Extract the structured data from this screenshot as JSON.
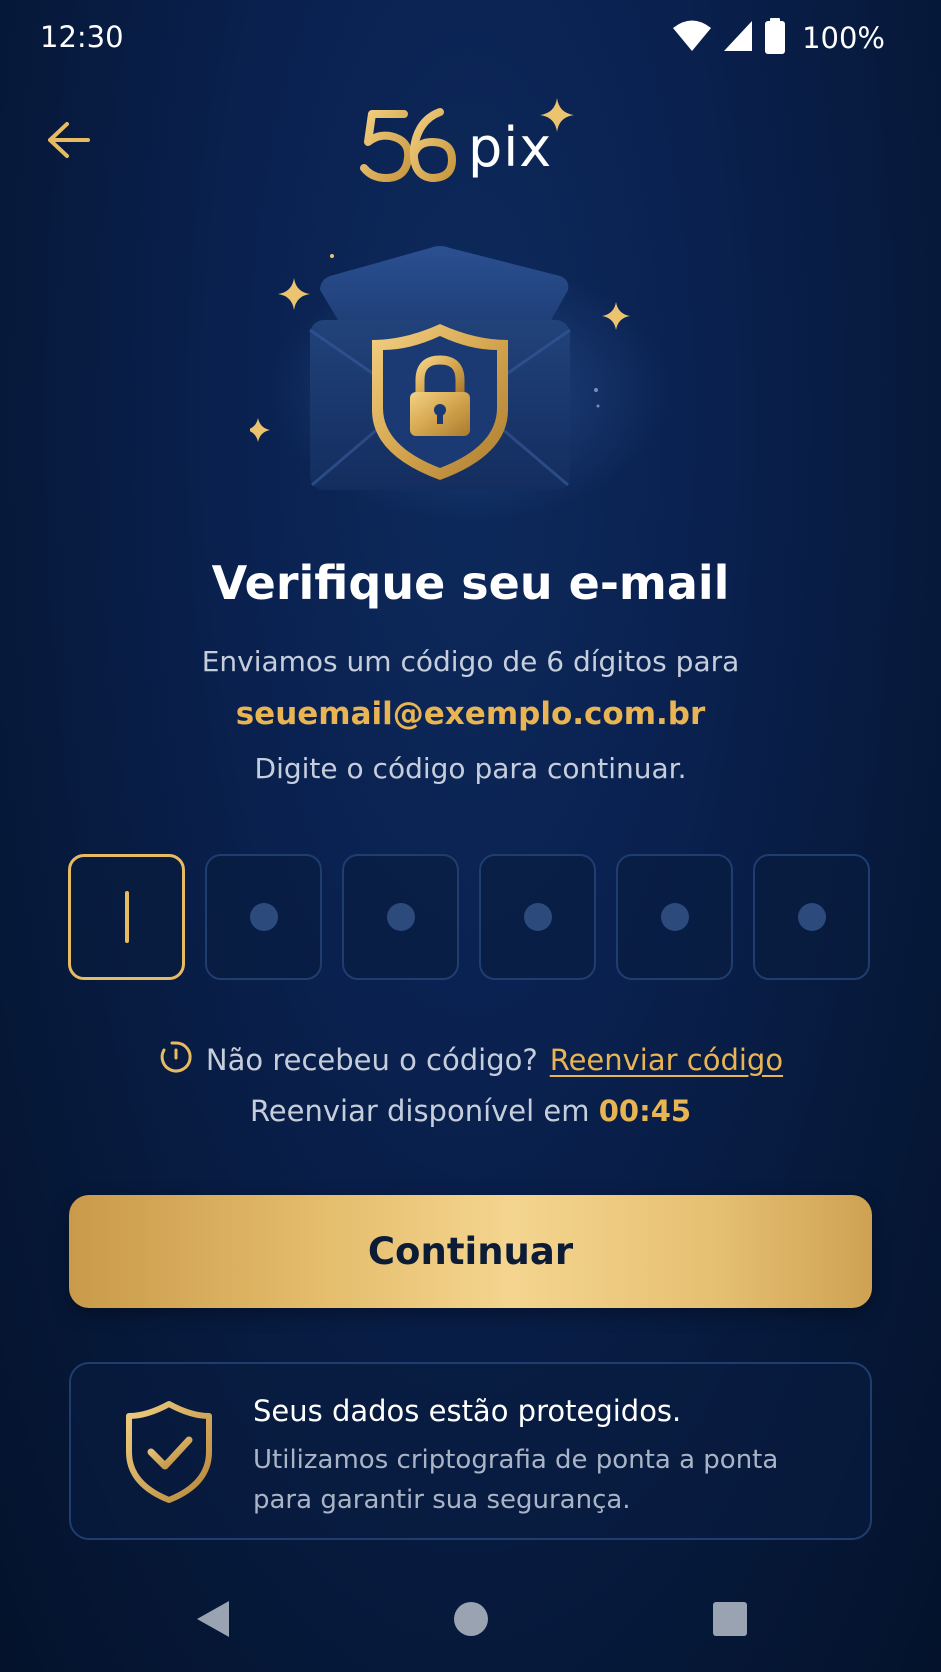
{
  "status_bar": {
    "time": "12:30",
    "battery_percent": "100%",
    "icons": [
      "wifi-icon",
      "cellular-signal-icon",
      "battery-icon"
    ]
  },
  "header": {
    "back_icon": "arrow-left-icon",
    "logo_number": "56",
    "logo_text": "pix"
  },
  "hero": {
    "illustration": "envelope-shield-lock-illustration"
  },
  "content": {
    "title": "Verifique seu e-mail",
    "subtitle": "Enviamos um código de 6 dígitos para",
    "email": "seuemail@exemplo.com.br",
    "instruction": "Digite o código para continuar."
  },
  "otp": {
    "length": 6,
    "active_index": 0,
    "values": [
      "",
      "",
      "",
      "",
      "",
      ""
    ]
  },
  "resend": {
    "question": "Não recebeu o código?",
    "link_label": "Reenviar código",
    "timer_prefix": "Reenviar disponível em",
    "timer_value": "00:45"
  },
  "actions": {
    "continue_label": "Continuar"
  },
  "security_notice": {
    "title": "Seus dados estão protegidos.",
    "body": "Utilizamos criptografia de ponta a ponta para garantir sua segurança."
  },
  "colors": {
    "accent_gold": "#e9b553",
    "background": "#0a2150",
    "text_secondary": "#c6cedb"
  }
}
